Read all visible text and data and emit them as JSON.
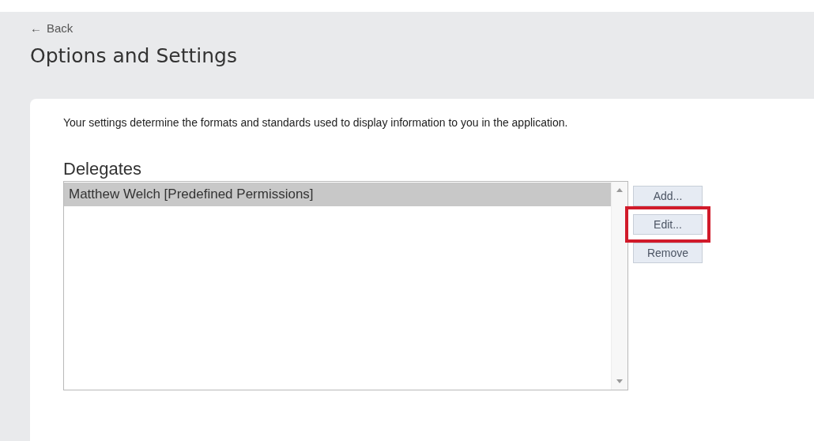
{
  "back_link": {
    "arrow": "←",
    "label": "Back"
  },
  "page_title": "Options and Settings",
  "description": "Your settings determine the formats and standards used to display information to you in the application.",
  "delegates": {
    "heading": "Delegates",
    "items": [
      {
        "label": "Matthew Welch [Predefined Permissions]",
        "selected": true
      }
    ],
    "buttons": [
      {
        "label": "Add...",
        "highlighted": false
      },
      {
        "label": "Edit...",
        "highlighted": true
      },
      {
        "label": "Remove",
        "highlighted": false
      }
    ]
  }
}
